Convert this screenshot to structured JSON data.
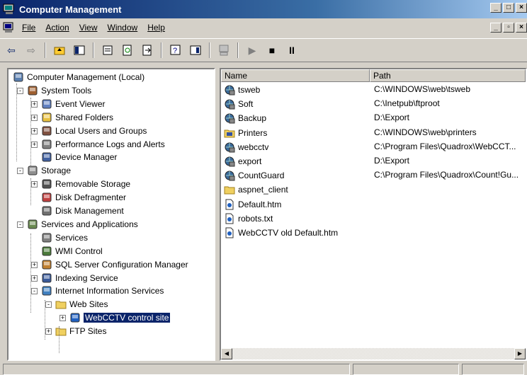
{
  "window": {
    "title": "Computer Management"
  },
  "menu": [
    "File",
    "Action",
    "View",
    "Window",
    "Help"
  ],
  "tree": [
    {
      "label": "Computer Management (Local)",
      "icon": "computer-icon"
    },
    {
      "label": "System Tools",
      "icon": "tools-icon"
    },
    {
      "label": "Event Viewer",
      "icon": "event-viewer-icon"
    },
    {
      "label": "Shared Folders",
      "icon": "shared-folder-icon"
    },
    {
      "label": "Local Users and Groups",
      "icon": "users-icon"
    },
    {
      "label": "Performance Logs and Alerts",
      "icon": "performance-icon"
    },
    {
      "label": "Device Manager",
      "icon": "device-manager-icon"
    },
    {
      "label": "Storage",
      "icon": "storage-icon"
    },
    {
      "label": "Removable Storage",
      "icon": "removable-storage-icon"
    },
    {
      "label": "Disk Defragmenter",
      "icon": "defrag-icon"
    },
    {
      "label": "Disk Management",
      "icon": "disk-icon"
    },
    {
      "label": "Services and Applications",
      "icon": "services-apps-icon"
    },
    {
      "label": "Services",
      "icon": "services-icon"
    },
    {
      "label": "WMI Control",
      "icon": "wmi-icon"
    },
    {
      "label": "SQL Server Configuration Manager",
      "icon": "sql-icon"
    },
    {
      "label": "Indexing Service",
      "icon": "indexing-icon"
    },
    {
      "label": "Internet Information Services",
      "icon": "iis-icon"
    },
    {
      "label": "Web Sites",
      "icon": "folder-icon"
    },
    {
      "label": "WebCCTV control site",
      "icon": "website-icon"
    },
    {
      "label": "FTP Sites",
      "icon": "folder-icon"
    }
  ],
  "list": {
    "columns": [
      "Name",
      "Path"
    ],
    "rows": [
      {
        "name": "tsweb",
        "path": "C:\\WINDOWS\\web\\tsweb",
        "icon": "virtual-dir-icon"
      },
      {
        "name": "Soft",
        "path": "C:\\Inetpub\\ftproot",
        "icon": "virtual-dir-icon"
      },
      {
        "name": "Backup",
        "path": "D:\\Export",
        "icon": "virtual-dir-icon"
      },
      {
        "name": "Printers",
        "path": "C:\\WINDOWS\\web\\printers",
        "icon": "printers-icon"
      },
      {
        "name": "webcctv",
        "path": "C:\\Program Files\\Quadrox\\WebCCT...",
        "icon": "virtual-dir-icon"
      },
      {
        "name": "export",
        "path": "D:\\Export",
        "icon": "virtual-dir-icon"
      },
      {
        "name": "CountGuard",
        "path": "C:\\Program Files\\Quadrox\\Count!Gu...",
        "icon": "virtual-dir-icon"
      },
      {
        "name": "aspnet_client",
        "path": "",
        "icon": "folder-icon"
      },
      {
        "name": "Default.htm",
        "path": "",
        "icon": "file-icon"
      },
      {
        "name": "robots.txt",
        "path": "",
        "icon": "file-icon"
      },
      {
        "name": "WebCCTV old Default.htm",
        "path": "",
        "icon": "file-icon"
      }
    ]
  },
  "colors": {
    "titlebar": "#0a246a",
    "selection": "#0a246a",
    "chrome": "#d4d0c8"
  }
}
